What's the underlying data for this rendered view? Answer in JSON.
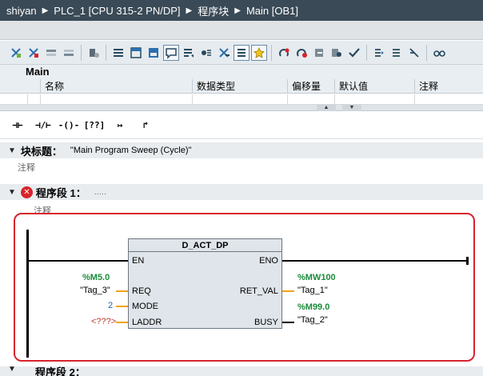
{
  "breadcrumb": {
    "items": [
      "shiyan",
      "PLC_1 [CPU 315-2 PN/DP]",
      "程序块",
      "Main [OB1]"
    ],
    "separator": "▶"
  },
  "interface": {
    "title": "Main",
    "columns": [
      "名称",
      "数据类型",
      "偏移量",
      "默认值",
      "注释"
    ]
  },
  "ladder_toolbar": {
    "items": [
      "⊣⊢",
      "⊣/⊢",
      "-()-",
      "[??]",
      "↦",
      "↱"
    ]
  },
  "block_title": {
    "label": "块标题：",
    "value": "\"Main Program Sweep (Cycle)\"",
    "comment": "注释"
  },
  "network1": {
    "label": "程序段 1：",
    "dots": ".....",
    "comment": "注释",
    "block": {
      "name": "D_ACT_DP",
      "in_pins": [
        "EN",
        "REQ",
        "MODE",
        "LADDR"
      ],
      "out_pins": [
        "ENO",
        "RET_VAL",
        "BUSY"
      ]
    },
    "operands": {
      "req_addr": "%M5.0",
      "req_sym": "\"Tag_3\"",
      "mode_val": "2",
      "laddr_val": "<???>",
      "retval_addr": "%MW100",
      "retval_sym": "\"Tag_1\"",
      "busy_addr": "%M99.0",
      "busy_sym": "\"Tag_2\""
    }
  },
  "network2": {
    "label": "程序段 2："
  },
  "colors": {
    "titlebar": "#3a4a57",
    "network_highlight": "#d9232d",
    "address_green": "#1b8a3b",
    "wire_orange": "#f0a21a"
  }
}
